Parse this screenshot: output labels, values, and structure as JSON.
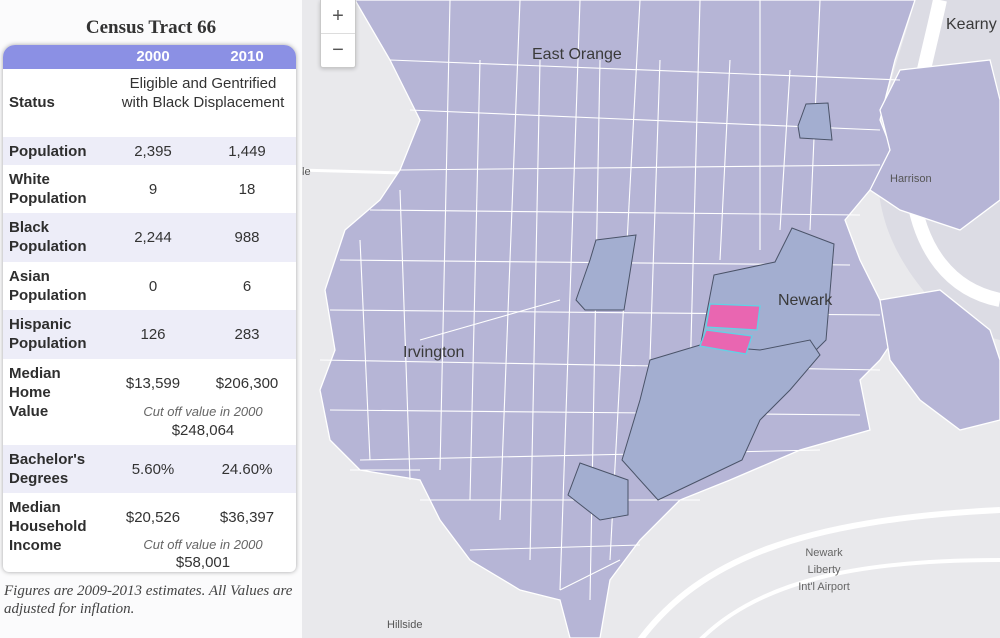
{
  "map": {
    "labels": {
      "east_orange": "East Orange",
      "kearny": "Kearny",
      "harrison": "Harrison",
      "newark": "Newark",
      "irvington": "Irvington",
      "hillside": "Hillside",
      "airport_line1": "Newark",
      "airport_line2": "Liberty",
      "airport_line3": "Int'l Airport",
      "edge_fragment": "le"
    },
    "zoom": {
      "in_label": "+",
      "out_label": "−"
    },
    "colors": {
      "tract_fill": "#b6b5d6",
      "tract_stroke": "#ffffff",
      "eligible_fill": "#a3aed0",
      "eligible_stroke": "#4a5368",
      "selected_fill": "#e966b1",
      "selected_stroke": "#5fd3e6",
      "background": "#e9e9ec"
    }
  },
  "sidebar": {
    "title": "Census Tract 66",
    "columns": [
      "2000",
      "2010"
    ],
    "rows": [
      {
        "label": "Status",
        "merged": "Eligible and Gentrified with Black Displacement"
      },
      {
        "label": "Population",
        "v2000": "2,395",
        "v2010": "1,449"
      },
      {
        "label": "White Population",
        "v2000": "9",
        "v2010": "18"
      },
      {
        "label": "Black Population",
        "v2000": "2,244",
        "v2010": "988"
      },
      {
        "label": "Asian Population",
        "v2000": "0",
        "v2010": "6"
      },
      {
        "label": "Hispanic Population",
        "v2000": "126",
        "v2010": "283"
      },
      {
        "label": "Median Home Value",
        "v2000": "$13,599",
        "v2010": "$206,300",
        "cutoff_note": "Cut off value in 2000",
        "cutoff_value": "$248,064"
      },
      {
        "label": "Bachelor's Degrees",
        "v2000": "5.60%",
        "v2010": "24.60%"
      },
      {
        "label": "Median Household Income",
        "v2000": "$20,526",
        "v2010": "$36,397",
        "cutoff_note": "Cut off value in 2000",
        "cutoff_value": "$58,001"
      }
    ],
    "footnote": "Figures are 2009-2013 estimates. All Values are adjusted for inflation."
  }
}
